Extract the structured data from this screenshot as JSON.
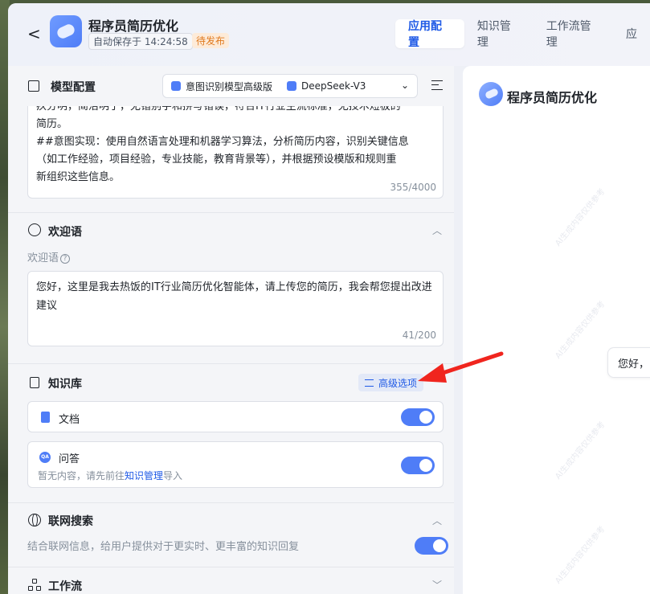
{
  "header": {
    "back_label": "<",
    "app_name": "程序员简历优化",
    "autosave": "自动保存于 14:24:58",
    "status": "待发布",
    "tabs": [
      {
        "label": "应用配置",
        "active": true
      },
      {
        "label": "知识管理",
        "active": false
      },
      {
        "label": "工作流管理",
        "active": false
      },
      {
        "label": "应",
        "active": false
      }
    ]
  },
  "model_config": {
    "title": "模型配置",
    "intent_model": "意图识别模型高级版",
    "llm_model": "DeepSeek-V3",
    "prompt_lines": [
      "疚分明，简洁明了，无错别字和拼写错误，符合IT行业主流标准，无技术短板的",
      "简历。",
      "##意图实现：使用自然语言处理和机器学习算法，分析简历内容，识别关键信息",
      "（如工作经验，项目经验，专业技能，教育背景等），并根据预设模版和规则重",
      "新组织这些信息。"
    ],
    "prompt_counter": "355/4000"
  },
  "welcome": {
    "title": "欢迎语",
    "label": "欢迎语",
    "help_icon": "?",
    "text": "您好，这里是我去热饭的IT行业简历优化智能体，请上传您的简历，我会帮您提出改进建议",
    "counter": "41/200"
  },
  "knowledge": {
    "title": "知识库",
    "advanced_label": "高级选项",
    "items": [
      {
        "title": "文档",
        "enabled": true
      },
      {
        "title": "问答",
        "qa_badge": "QA",
        "desc_prefix": "暂无内容，请先前往",
        "desc_link": "知识管理",
        "desc_suffix": "导入",
        "enabled": true
      }
    ]
  },
  "web_search": {
    "title": "联网搜索",
    "desc": "结合联网信息，给用户提供对于更实时、更丰富的知识回复",
    "enabled": true
  },
  "workflow": {
    "title": "工作流"
  },
  "preview": {
    "title": "程序员简历优化",
    "bubble": "您好，",
    "watermark": "AI生成内容仅供参考"
  },
  "colors": {
    "accent": "#4f7df7",
    "link": "#1f5ae6",
    "status_text": "#e07a1f",
    "annotation_arrow": "#f0251e"
  }
}
